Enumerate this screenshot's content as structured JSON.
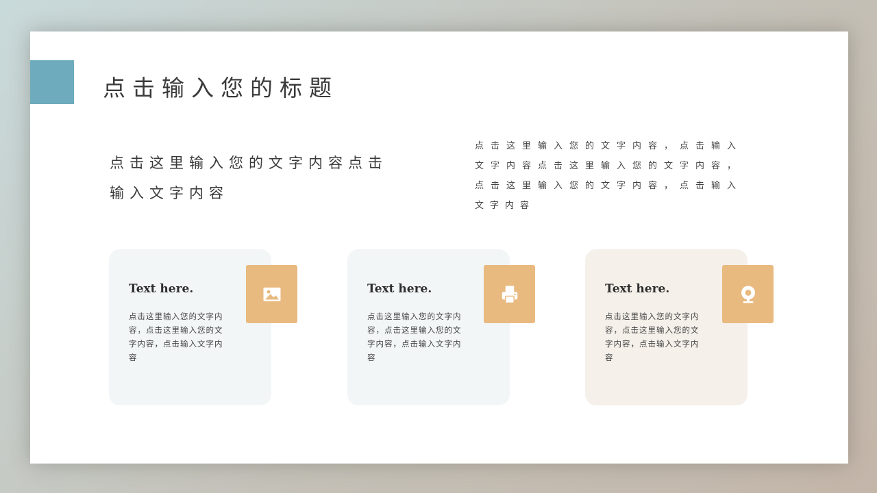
{
  "slide": {
    "title": "点击输入您的标题",
    "lead_text": "点击这里输入您的文字内容点击输入文字内容",
    "side_text": "点击这里输入您的文字内容，点击输入文字内容点击这里输入您的文字内容，点击这里输入您的文字内容，点击输入文字内容"
  },
  "cards": [
    {
      "heading": "Text here.",
      "body": "点击这里输入您的文字内容，点击这里输入您的文字内容，点击输入文字内容",
      "icon": "image-icon"
    },
    {
      "heading": "Text here.",
      "body": "点击这里输入您的文字内容，点击这里输入您的文字内容，点击输入文字内容",
      "icon": "printer-icon"
    },
    {
      "heading": "Text here.",
      "body": "点击这里输入您的文字内容，点击这里输入您的文字内容，点击输入文字内容",
      "icon": "webcam-icon"
    }
  ],
  "colors": {
    "accent_blue": "#6eabbd",
    "icon_box": "#e8ba80",
    "card_cool": "#f2f6f6",
    "card_warm": "#f5f0ea"
  }
}
